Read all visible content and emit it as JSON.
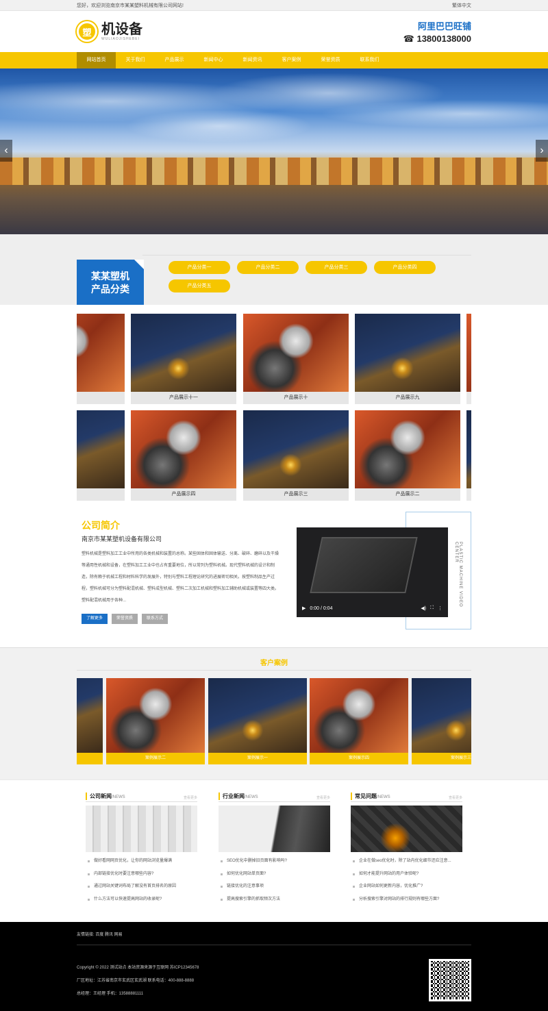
{
  "topbar": {
    "welcome": "您好，欢迎浏览南京市某某塑料机械有限公司网站!",
    "lang": "繁体中文"
  },
  "header": {
    "logo_glyph": "塑",
    "logo_title": "机设备",
    "logo_sub": "WULIAOJISHEBEI",
    "contact_shop": "阿里巴巴旺铺",
    "contact_phone": "☎ 13800138000"
  },
  "nav": [
    "网站首页",
    "关于我们",
    "产品展示",
    "新闻中心",
    "新闻资讯",
    "客户案例",
    "荣誉资质",
    "联系我们"
  ],
  "banner": {
    "prev": "‹",
    "next": "›"
  },
  "category": {
    "title_l1": "某某塑机",
    "title_l2": "产品分类",
    "items": [
      "产品分类一",
      "产品分类二",
      "产品分类三",
      "产品分类四",
      "产品分类五"
    ]
  },
  "products": {
    "row1": [
      "十二",
      "产品展示十一",
      "产品展示十",
      "产品展示九"
    ],
    "row2": [
      "示五",
      "产品展示四",
      "产品展示三",
      "产品展示二"
    ]
  },
  "about": {
    "title": "公司简介",
    "company": "南京市某某塑机设备有限公司",
    "text": "塑料机械是塑料加工工业中所用的各类机械和装置的总称。某些固体和固体输送、分离、破碎、磨碎以及干燥等通用性机械和设备，在塑料加工工业中也占有重要地位，所以常列为塑料机械。现代塑料机械的设计和制造，除有赖于机械工程和材料科学的发展外，特别与塑料工程理论研究的进展密切相关。按塑料制品生产过程，塑料机械可分为塑料配混机械、塑料成型机械、塑料二次加工机械和塑料加工辅助机械或装置等四大类。塑料配混机械用于各种...",
    "btn_more": "了解更多",
    "btn_honor": "荣誉资质",
    "btn_contact": "联系方式",
    "video_side": "PLASTIC MACHINE VIDEO CENTER",
    "video_time": "0:00 / 0:04"
  },
  "cases": {
    "title": "客户案例",
    "items": [
      "",
      "案例展示二",
      "案例展示一",
      "案例展示四",
      "案例展示三"
    ]
  },
  "news": [
    {
      "title": "公司新闻",
      "tag": "/NEWS",
      "more": "查看更多",
      "items": [
        "做好看网网页优化，让你的网站浏览量爆满",
        "内部链接优化时要注意哪些内容?",
        "通过网站关键词布局了解没有首页排名的原因",
        "什么方法可以快速提高网站的收录呢?"
      ]
    },
    {
      "title": "行业新闻",
      "tag": "/NEWS",
      "more": "查看更多",
      "items": [
        "SEO优化中删掉旧页面有影响吗?",
        "如何优化网站单页面?",
        "链接优化的注意事项",
        "提高搜索引擎的抓取频次方法"
      ]
    },
    {
      "title": "常见问题",
      "tag": "/NEWS",
      "more": "查看更多",
      "items": [
        "企业在做seo优化时，除了站内优化细节还应注意...",
        "如何才能提升网站的用户体验呢?",
        "企业网站如何更新内容，优化推广?",
        "分析搜索引擎对网站的排行规则有哪些方面?"
      ]
    }
  ],
  "footer": {
    "links": "友情链接:   百度  腾讯  网易",
    "copyright": "Copyright © 2022 测试站点 本站资源来源于互联网   苏ICP12345678",
    "address": "厂区地址：江苏省南京市玄武区玄武湖      联系电话：400-888-8888",
    "manager": "总经理：王经理         手机：13588881111"
  }
}
